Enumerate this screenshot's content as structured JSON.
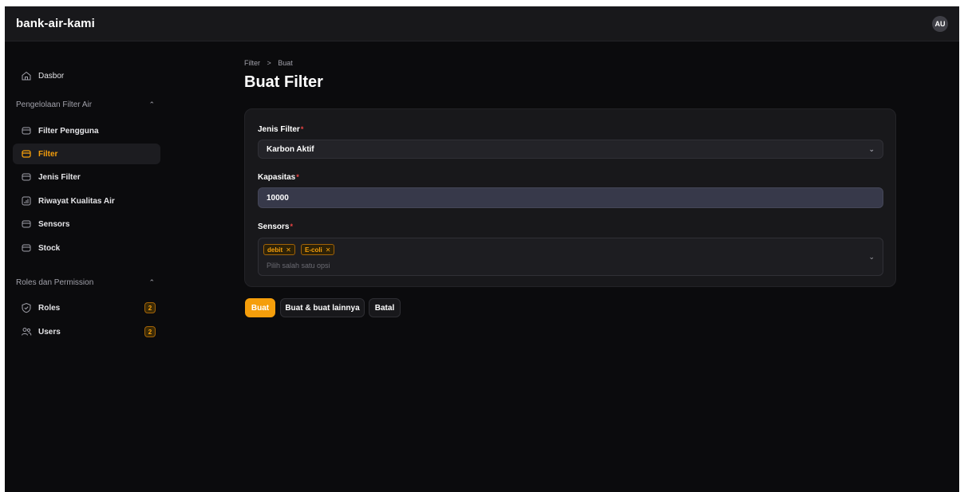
{
  "app": {
    "name": "bank-air-kami",
    "user_initials": "AU"
  },
  "sidebar": {
    "dashboard": {
      "label": "Dasbor",
      "icon": "home-icon"
    },
    "groups": [
      {
        "label": "Pengelolaan Filter Air",
        "items": [
          {
            "label": "Filter Pengguna",
            "icon": "box-icon"
          },
          {
            "label": "Filter",
            "icon": "box-icon",
            "active": true
          },
          {
            "label": "Jenis Filter",
            "icon": "box-icon"
          },
          {
            "label": "Riwayat Kualitas Air",
            "icon": "chart-icon"
          },
          {
            "label": "Sensors",
            "icon": "box-icon"
          },
          {
            "label": "Stock",
            "icon": "box-icon"
          }
        ]
      },
      {
        "label": "Roles dan Permission",
        "items": [
          {
            "label": "Roles",
            "icon": "shield-icon",
            "badge": "2"
          },
          {
            "label": "Users",
            "icon": "users-icon",
            "badge": "2"
          }
        ]
      }
    ]
  },
  "breadcrumb": {
    "parent": "Filter",
    "separator": ">",
    "current": "Buat"
  },
  "page_title": "Buat Filter",
  "form": {
    "jenis_filter": {
      "label": "Jenis Filter",
      "required_mark": "*",
      "value": "Karbon Aktif"
    },
    "kapasitas": {
      "label": "Kapasitas",
      "required_mark": "*",
      "value": "10000"
    },
    "sensors": {
      "label": "Sensors",
      "required_mark": "*",
      "tags": [
        "debit",
        "E-coli"
      ],
      "placeholder": "Pilih salah satu opsi"
    }
  },
  "actions": {
    "create": "Buat",
    "create_another": "Buat & buat lainnya",
    "cancel": "Batal"
  },
  "colors": {
    "accent": "#f59e0b",
    "background": "#0b0b0d",
    "panel": "#18181b"
  }
}
